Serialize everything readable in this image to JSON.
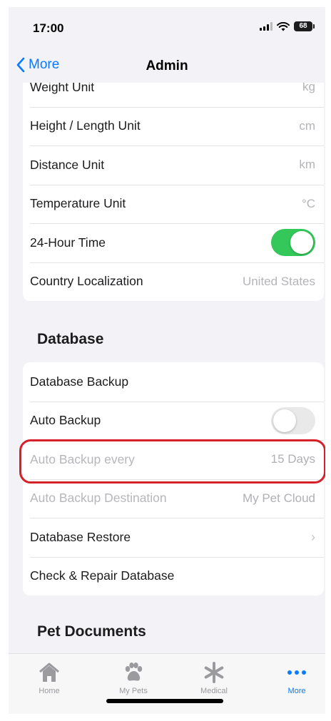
{
  "status_bar": {
    "time": "17:00",
    "battery": "68"
  },
  "nav": {
    "back_label": "More",
    "title": "Admin"
  },
  "units_group": {
    "rows": [
      {
        "label": "Weight Unit",
        "value": "kg"
      },
      {
        "label": "Height / Length Unit",
        "value": "cm"
      },
      {
        "label": "Distance Unit",
        "value": "km"
      },
      {
        "label": "Temperature Unit",
        "value": "°C"
      },
      {
        "label": "24-Hour Time",
        "toggle": true
      },
      {
        "label": "Country Localization",
        "value": "United States"
      }
    ]
  },
  "database": {
    "header": "Database",
    "rows": [
      {
        "label": "Database Backup"
      },
      {
        "label": "Auto Backup",
        "toggle": false
      },
      {
        "label": "Auto Backup every",
        "value": "15 Days"
      },
      {
        "label": "Auto Backup Destination",
        "value": "My Pet Cloud"
      },
      {
        "label": "Database Restore",
        "chevron": "›"
      },
      {
        "label": "Check & Repair Database"
      }
    ]
  },
  "pet_documents": {
    "header": "Pet Documents"
  },
  "tab_bar": {
    "tabs": [
      {
        "label": "Home",
        "icon": "house-icon"
      },
      {
        "label": "My Pets",
        "icon": "paw-icon"
      },
      {
        "label": "Medical",
        "icon": "asterisk-icon"
      },
      {
        "label": "More",
        "icon": "ellipsis-icon",
        "active": true
      }
    ]
  },
  "colors": {
    "accent": "#0a7aff",
    "toggle_on": "#34c759",
    "highlight": "#d6202a"
  }
}
